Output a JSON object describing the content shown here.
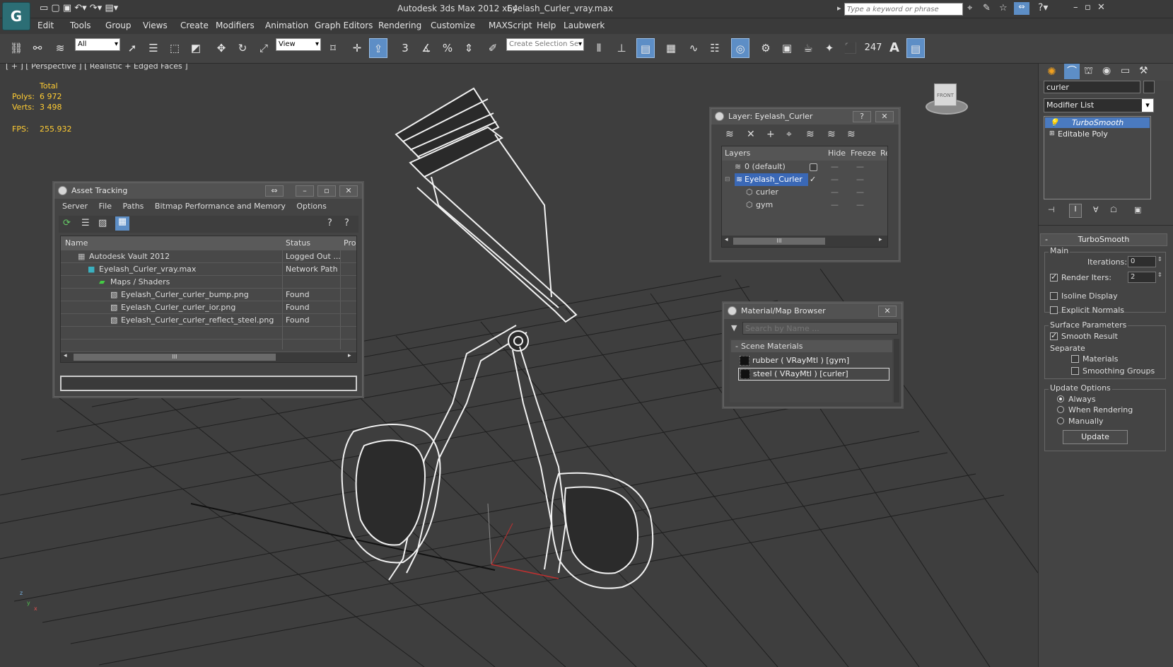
{
  "titlebar": {
    "app": "Autodesk 3ds Max  2012 x64",
    "file": "Eyelash_Curler_vray.max",
    "search_placeholder": "Type a keyword or phrase"
  },
  "menu": [
    "Edit",
    "Tools",
    "Group",
    "Views",
    "Create",
    "Modifiers",
    "Animation",
    "Graph Editors",
    "Rendering",
    "Customize",
    "MAXScript",
    "Help",
    "Laubwerk"
  ],
  "toolbar": {
    "filter_value": "All",
    "refcoord_value": "View",
    "selection_set_placeholder": "Create Selection Se",
    "angle_snap": "3",
    "counter": "247",
    "text_tool": "A"
  },
  "viewport": {
    "label": "[ + ] [ Perspective ] [ Realistic + Edged Faces ]",
    "stats_header": "Total",
    "polys_label": "Polys:",
    "polys_value": "6 972",
    "verts_label": "Verts:",
    "verts_value": "3 498",
    "fps_label": "FPS:",
    "fps_value": "255.932",
    "viewcube_face": "FRONT",
    "axis_labels": {
      "x": "x",
      "y": "y",
      "z": "z"
    }
  },
  "asset_tracking": {
    "title": "Asset Tracking",
    "menu": [
      "Server",
      "File",
      "Paths",
      "Bitmap Performance and Memory",
      "Options"
    ],
    "columns": [
      "Name",
      "Status",
      "Pro"
    ],
    "rows": [
      {
        "name": "Autodesk Vault 2012",
        "status": "Logged Out ..."
      },
      {
        "name": "Eyelash_Curler_vray.max",
        "status": "Network Path"
      },
      {
        "name": "Maps / Shaders",
        "status": ""
      },
      {
        "name": "Eyelash_Curler_curler_bump.png",
        "status": "Found"
      },
      {
        "name": "Eyelash_Curler_curler_ior.png",
        "status": "Found"
      },
      {
        "name": "Eyelash_Curler_curler_reflect_steel.png",
        "status": "Found"
      }
    ],
    "scroll_grip": "III"
  },
  "layer_window": {
    "title": "Layer: Eyelash_Curler",
    "columns": [
      "Layers",
      "Hide",
      "Freeze",
      "Re"
    ],
    "rows": [
      {
        "name": "0 (default)"
      },
      {
        "name": "Eyelash_Curler"
      },
      {
        "name": "curler"
      },
      {
        "name": "gym"
      }
    ],
    "scroll_grip": "III",
    "help_label": "?",
    "close_label": "✕"
  },
  "material_browser": {
    "title": "Material/Map Browser",
    "search_placeholder": "Search by Name ...",
    "group_label": "Scene Materials",
    "group_toggle": "-",
    "items": [
      "rubber  ( VRayMtl )  [gym]",
      "steel  ( VRayMtl )  [curler]"
    ]
  },
  "command_panel": {
    "object_name": "curler",
    "modifier_list": "Modifier List",
    "stack": [
      "TurboSmooth",
      "Editable Poly"
    ],
    "rollout_title": "TurboSmooth",
    "rollout_toggle": "-",
    "main_group": "Main",
    "iterations_label": "Iterations:",
    "iterations_value": "0",
    "render_iters_label": "Render Iters:",
    "render_iters_value": "2",
    "isoline": "Isoline Display",
    "explicit_normals": "Explicit Normals",
    "surface_group": "Surface Parameters",
    "smooth_result": "Smooth Result",
    "separate": "Separate",
    "materials": "Materials",
    "smoothing_groups": "Smoothing Groups",
    "update_group": "Update Options",
    "always": "Always",
    "when_rendering": "When Rendering",
    "manually": "Manually",
    "update_button": "Update"
  }
}
